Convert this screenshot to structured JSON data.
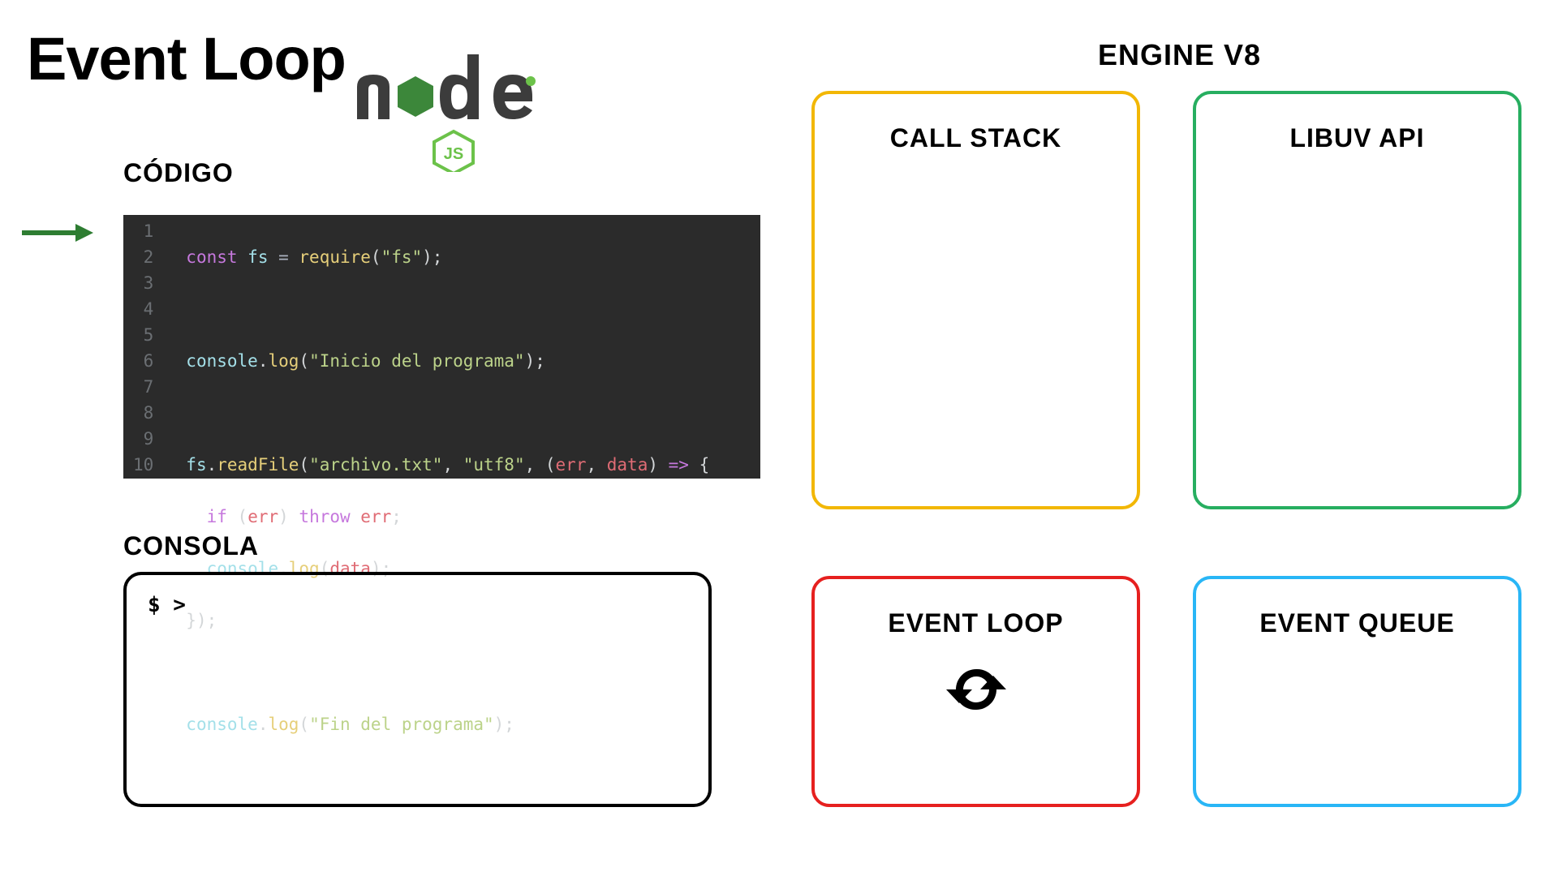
{
  "title": "Event Loop",
  "engine_label": "ENGINE V8",
  "sections": {
    "codigo": "CÓDIGO",
    "consola": "CONSOLA"
  },
  "code": {
    "line_numbers": [
      "1",
      "2",
      "3",
      "4",
      "5",
      "6",
      "7",
      "8",
      "9",
      "10"
    ],
    "lines": {
      "l1_const": "const",
      "l1_fs": "fs",
      "l1_eq": " = ",
      "l1_require": "require",
      "l1_q1": "(",
      "l1_str": "\"fs\"",
      "l1_q2": ");",
      "l3_console": "console",
      "l3_dot": ".",
      "l3_log": "log",
      "l3_p1": "(",
      "l3_str": "\"Inicio del programa\"",
      "l3_p2": ");",
      "l5_fs": "fs",
      "l5_dot": ".",
      "l5_read": "readFile",
      "l5_p1": "(",
      "l5_str1": "\"archivo.txt\"",
      "l5_c1": ", ",
      "l5_str2": "\"utf8\"",
      "l5_c2": ", (",
      "l5_err": "err",
      "l5_c3": ", ",
      "l5_data": "data",
      "l5_p2": ") ",
      "l5_arrow": "=>",
      "l5_brace": " {",
      "l6_if": "if",
      "l6_p1": " (",
      "l6_err": "err",
      "l6_p2": ") ",
      "l6_throw": "throw",
      "l6_sp": " ",
      "l6_err2": "err",
      "l6_semi": ";",
      "l7_console": "console",
      "l7_dot": ".",
      "l7_log": "log",
      "l7_p1": "(",
      "l7_data": "data",
      "l7_p2": ");",
      "l8_close": "});",
      "l10_console": "console",
      "l10_dot": ".",
      "l10_log": "log",
      "l10_p1": "(",
      "l10_str": "\"Fin del programa\"",
      "l10_p2": ");"
    }
  },
  "console_prompt": "$ >",
  "panels": {
    "call_stack": "CALL STACK",
    "libuv_api": "LIBUV API",
    "event_loop": "EVENT LOOP",
    "event_queue": "EVENT QUEUE"
  },
  "colors": {
    "call_stack": "#f2b705",
    "libuv_api": "#27ae60",
    "event_loop": "#e6201f",
    "event_queue": "#29b6f6",
    "arrow": "#2e7d32"
  }
}
